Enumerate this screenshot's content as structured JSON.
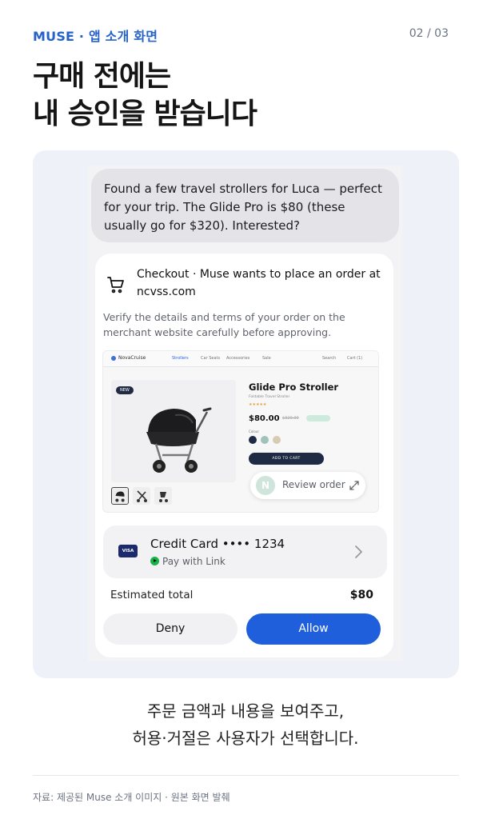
{
  "header": {
    "eyebrow": "MUSE · 앱 소개 화면",
    "page_indicator": "02 / 03",
    "title_lines": [
      "구매 전에는",
      "내 승인을 받습니다"
    ]
  },
  "chat": {
    "assistant_message": "Found a few travel strollers for Luca — perfect for your trip. The Glide Pro is $80 (these usually go for $320). Interested?"
  },
  "checkout": {
    "title": "Checkout · Muse wants to place an order at ncvss.com",
    "description": "Verify the details and terms of your order on the merchant website carefully before approving.",
    "icon": "cart-icon",
    "merchant_preview": {
      "brand": "NovaCruise",
      "nav": [
        "Strollers",
        "Car Seats",
        "Accessories",
        "Sale"
      ],
      "nav_right": [
        "Search",
        "Cart (1)"
      ],
      "badge": "NEW",
      "product_name": "Glide Pro Stroller",
      "product_subtitle": "Foldable Travel Stroller",
      "rating": "★★★★★",
      "price": "$80.00",
      "old_price": "$320.00",
      "colour_label": "Colour",
      "swatch_colors": [
        "#1f2a44",
        "#9fc3b8",
        "#d8cbb4"
      ],
      "add_to_cart": "ADD TO CART"
    },
    "review": {
      "avatar_letter": "N",
      "label": "Review order",
      "icon": "expand-icon"
    },
    "payment": {
      "card_brand": "VISA",
      "card_label": "Credit Card •••• 1234",
      "link_label": "Pay with Link"
    },
    "total": {
      "label": "Estimated total",
      "value": "$80"
    },
    "buttons": {
      "deny": "Deny",
      "allow": "Allow"
    }
  },
  "caption": {
    "line1": "주문 금액과 내용을 보여주고,",
    "line2": "허용·거절은 사용자가 선택합니다."
  },
  "footer": {
    "source": "자료: 제공된 Muse 소개 이미지 · 원본 화면 발췌"
  },
  "colors": {
    "accent": "#2563c9",
    "allow_button": "#1f5fdc",
    "panel_bg": "#eef1f7"
  }
}
